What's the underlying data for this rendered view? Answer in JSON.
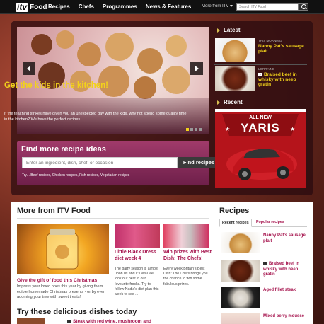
{
  "header": {
    "logo_itv": "itv",
    "logo_food": "Food",
    "nav": [
      "Recipes",
      "Chefs",
      "Programmes",
      "News & Features"
    ],
    "more_itv": "More from ITV",
    "search_placeholder": "Search ITV Food"
  },
  "hero": {
    "title": "Get the kids in the kitchen!",
    "description": "If the teaching strikes have given you an unexpected day with the kids, why not spend some quality time in the kitchen? We have the perfect recipes..."
  },
  "find": {
    "title": "Find more recipe ideas",
    "placeholder": "Enter an ingredient, dish, chef, or occasion",
    "button": "Find recipes",
    "links": "Try... Beef recipes, Chicken recipes, Fish recipes, Vegetarian recipes"
  },
  "latest": {
    "heading": "Latest",
    "items": [
      {
        "tag": "THIS MORNING",
        "title": "Nanny Pat's sausage plait",
        "video": false
      },
      {
        "tag": "LORRAINE",
        "title": "Braised beef in whisky with neep gratin",
        "video": true
      }
    ]
  },
  "recent": {
    "heading": "Recent"
  },
  "ad": {
    "line1": "ALL NEW",
    "line2": "YARIS"
  },
  "more": {
    "title": "More from ITV Food",
    "feature": {
      "title": "Give the gift of food this Christmas",
      "desc": "Impress your loved ones this year by giving them edible homemade Christmas presents - or by even adorning your tree with sweet treats!"
    },
    "cards": [
      {
        "title": "Little Black Dress diet week 4",
        "desc": "The party season is almost upon us and it's vital we look our best in our favourite frocks. Try to follow Nadia's diet plan this week to see ..."
      },
      {
        "title": "Win prizes with Best Dish: The Chefs!",
        "desc": "Every week Britain's Best Dish: The Chefs brings you the chance to win some fabulous prizes."
      }
    ]
  },
  "try": {
    "title": "Try these delicious dishes today",
    "item": "Steak with red wine, mushroom and"
  },
  "recipes": {
    "title": "Recipes",
    "tab_active": "Recent recipes",
    "tab_inactive": "Popular recipes",
    "items": [
      {
        "title": "Nanny Pat's sausage plait",
        "video": false
      },
      {
        "title": "Braised beef in whisky with neep gratin",
        "video": true
      },
      {
        "title": "Aged fillet steak",
        "video": false
      },
      {
        "title": "Mixed berry mousse",
        "video": false
      }
    ]
  }
}
